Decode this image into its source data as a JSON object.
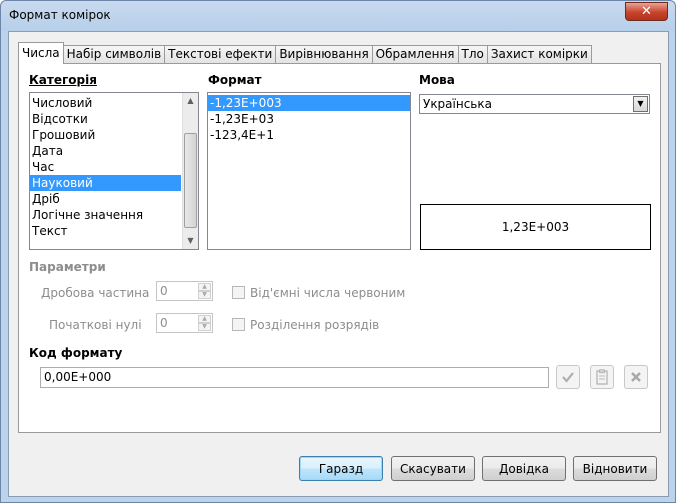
{
  "window": {
    "title": "Формат комірок",
    "close_glyph": "✕"
  },
  "tabs": [
    {
      "label": "Числа",
      "active": true
    },
    {
      "label": "Набір символів"
    },
    {
      "label": "Текстові ефекти"
    },
    {
      "label": "Вирівнювання"
    },
    {
      "label": "Обрамлення"
    },
    {
      "label": "Тло"
    },
    {
      "label": "Захист комірки"
    }
  ],
  "category": {
    "label": "Категорія",
    "items": [
      "Числовий",
      "Відсотки",
      "Грошовий",
      "Дата",
      "Час",
      "Науковий",
      "Дріб",
      "Логічне значення",
      "Текст"
    ],
    "selected": "Науковий"
  },
  "format": {
    "label": "Формат",
    "items": [
      "-1,23E+003",
      "-1,23E+03",
      "-123,4E+1"
    ],
    "selected": "-1,23E+003"
  },
  "language": {
    "label": "Мова",
    "value": "Українська"
  },
  "preview": {
    "text": "1,23E+003"
  },
  "options": {
    "label": "Параметри",
    "decimal_label": "Дробова частина",
    "decimal_value": "0",
    "leading_zeros_label": "Початкові нулі",
    "leading_zeros_value": "0",
    "negative_red_label": "Від'ємні числа червоним",
    "thousands_sep_label": "Розділення розрядів"
  },
  "format_code": {
    "label": "Код формату",
    "value": "0,00E+000"
  },
  "buttons": {
    "ok": "Гаразд",
    "cancel": "Скасувати",
    "help": "Довідка",
    "reset": "Відновити"
  }
}
